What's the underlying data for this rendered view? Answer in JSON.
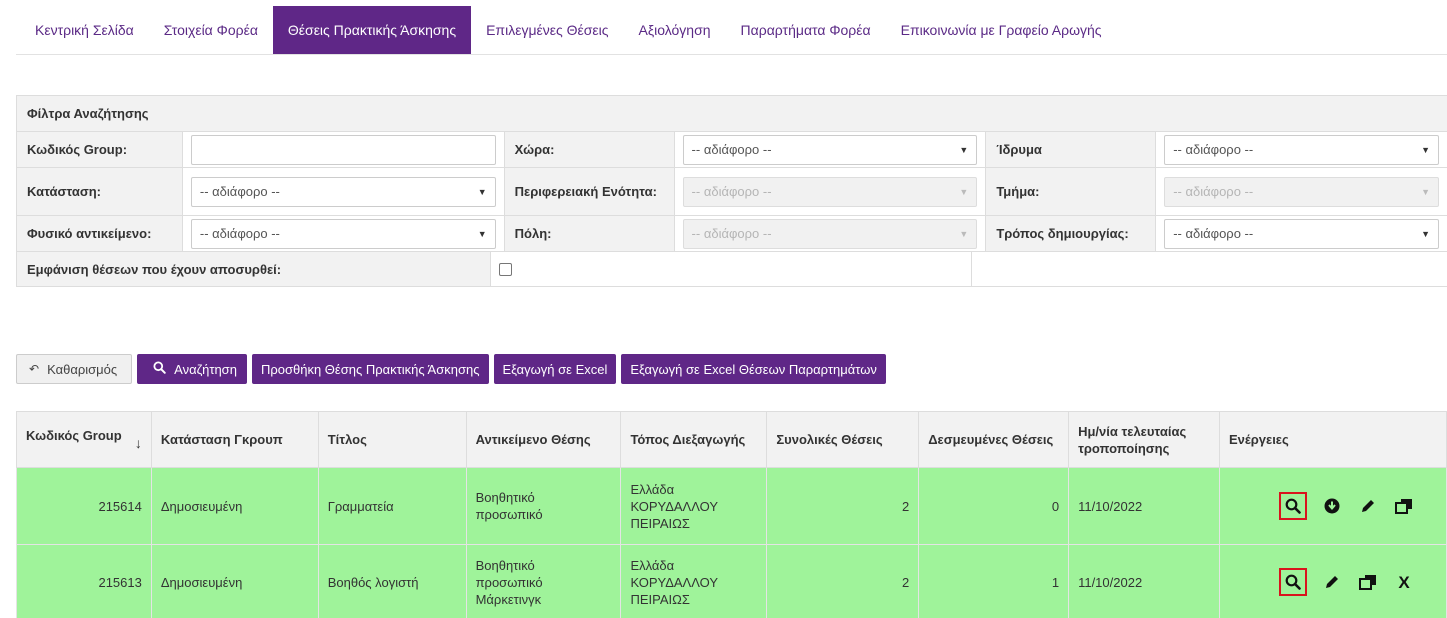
{
  "nav": {
    "tabs": [
      {
        "label": "Κεντρική Σελίδα",
        "active": false
      },
      {
        "label": "Στοιχεία Φορέα",
        "active": false
      },
      {
        "label": "Θέσεις Πρακτικής Άσκησης",
        "active": true
      },
      {
        "label": "Επιλεγμένες Θέσεις",
        "active": false
      },
      {
        "label": "Αξιολόγηση",
        "active": false
      },
      {
        "label": "Παραρτήματα Φορέα",
        "active": false
      },
      {
        "label": "Επικοινωνία με Γραφείο Αρωγής",
        "active": false
      }
    ]
  },
  "filters": {
    "title": "Φίλτρα Αναζήτησης",
    "group_code_label": "Κωδικός Group:",
    "group_code_value": "",
    "country_label": "Χώρα:",
    "country_value": "-- αδιάφορο --",
    "institution_label": "Ίδρυμα",
    "institution_value": "-- αδιάφορο --",
    "status_label": "Κατάσταση:",
    "status_value": "-- αδιάφορο --",
    "region_label": "Περιφερειακή Ενότητα:",
    "region_value": "-- αδιάφορο --",
    "department_label": "Τμήμα:",
    "department_value": "-- αδιάφορο --",
    "object_label": "Φυσικό αντικείμενο:",
    "object_value": "-- αδιάφορο --",
    "city_label": "Πόλη:",
    "city_value": "-- αδιάφορο --",
    "creation_label": "Τρόπος δημιουργίας:",
    "creation_value": "-- αδιάφορο --",
    "withdrawn_label": "Εμφάνιση θέσεων που έχουν αποσυρθεί:",
    "withdrawn_checked": false
  },
  "buttons": {
    "clear": "Καθαρισμός",
    "search": "Αναζήτηση",
    "add": "Προσθήκη Θέσης Πρακτικής Άσκησης",
    "export": "Εξαγωγή σε Excel",
    "export_branches": "Εξαγωγή σε Excel Θέσεων Παραρτημάτων"
  },
  "table": {
    "headers": [
      "Κωδικός Group",
      "Κατάσταση Γκρουπ",
      "Τίτλος",
      "Αντικείμενο Θέσης",
      "Τόπος Διεξαγωγής",
      "Συνολικές Θέσεις",
      "Δεσμευμένες Θέσεις",
      "Ημ/νία τελευταίας τροποποίησης",
      "Ενέργειες"
    ],
    "sort_indicator": "↓",
    "rows": [
      {
        "code": "215614",
        "status": "Δημοσιευμένη",
        "title": "Γραμματεία",
        "object": [
          "Βοηθητικό",
          "προσωπικό"
        ],
        "location": [
          "Ελλάδα",
          "ΚΟΡΥΔΑΛΛΟΥ",
          "ΠΕΙΡΑΙΩΣ"
        ],
        "total": "2",
        "reserved": "0",
        "date": "11/10/2022",
        "actions": [
          "search-icon",
          "download-icon",
          "edit-icon",
          "copy-icon"
        ]
      },
      {
        "code": "215613",
        "status": "Δημοσιευμένη",
        "title": "Βοηθός λογιστή",
        "object": [
          "Βοηθητικό",
          "προσωπικό",
          "Μάρκετινγκ"
        ],
        "location": [
          "Ελλάδα",
          "ΚΟΡΥΔΑΛΛΟΥ",
          "ΠΕΙΡΑΙΩΣ"
        ],
        "total": "2",
        "reserved": "1",
        "date": "11/10/2022",
        "actions": [
          "search-icon",
          "edit-icon",
          "copy-icon",
          "delete-icon"
        ],
        "delete_glyph": "X"
      }
    ]
  },
  "colors": {
    "accent": "#5f2787",
    "row_bg": "#9ff39a",
    "highlight": "#d9141d"
  }
}
